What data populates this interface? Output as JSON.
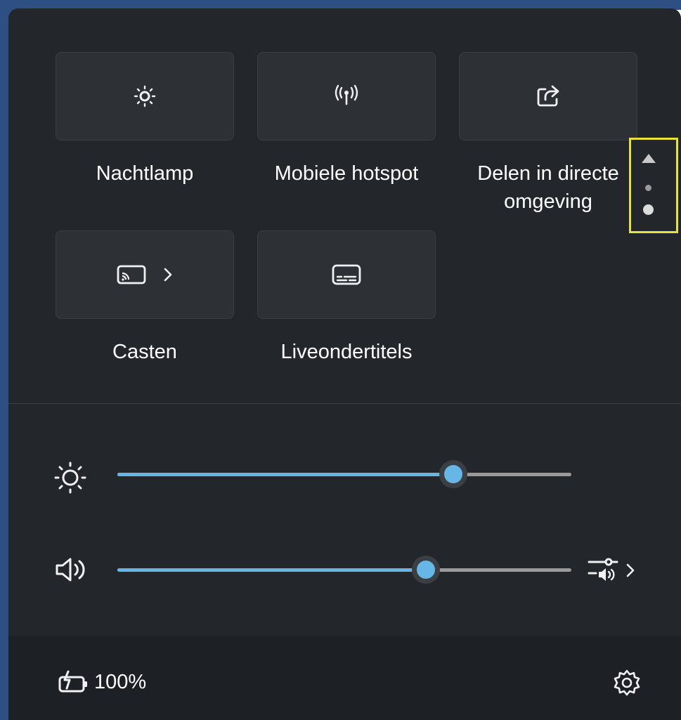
{
  "quick_settings": {
    "tiles": [
      {
        "label": "Nachtlamp",
        "icon": "night-light-icon"
      },
      {
        "label": "Mobiele hotspot",
        "icon": "hotspot-icon"
      },
      {
        "label": "Delen in directe omgeving",
        "icon": "nearby-share-icon"
      },
      {
        "label": "Casten",
        "icon": "cast-icon"
      },
      {
        "label": "Liveondertitels",
        "icon": "live-captions-icon"
      }
    ],
    "pager": {
      "current_page": 2,
      "total_pages": 2
    }
  },
  "sliders": {
    "brightness": {
      "icon": "brightness-icon",
      "value_percent": 74
    },
    "volume": {
      "icon": "volume-icon",
      "value_percent": 68,
      "extra_icon": "audio-output-icon"
    }
  },
  "footer": {
    "battery_icon": "battery-charging-icon",
    "battery_text": "100%",
    "settings_icon": "settings-gear-icon"
  },
  "colors": {
    "panel": "#23272c",
    "tile": "#2d3136",
    "accent": "#66b6e6",
    "highlight": "#e8e33a"
  }
}
